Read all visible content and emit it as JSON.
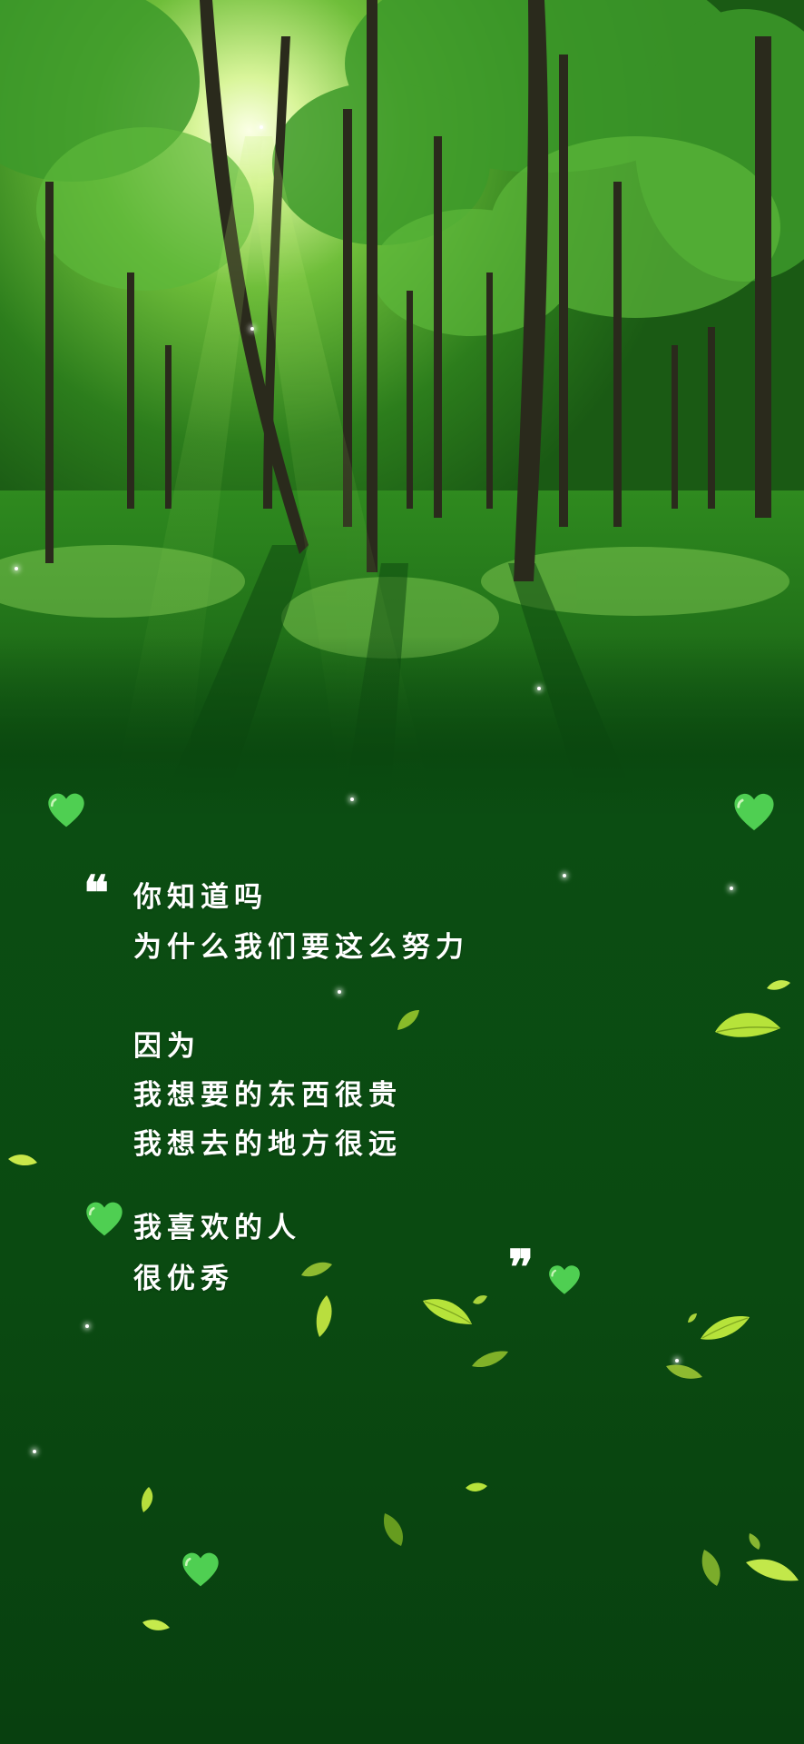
{
  "quote": {
    "open_mark": "❝",
    "close_mark": "❞",
    "lines": [
      "你知道吗",
      "为什么我们要这么努力",
      "因为",
      "我想要的东西很贵",
      "我想去的地方很远",
      "我喜欢的人",
      "很优秀"
    ]
  },
  "colors": {
    "background": "#0b4d12",
    "heart": "#4fcf52",
    "leaf": "#b6e33a",
    "text": "#ffffff"
  },
  "icons": [
    "green-heart-icon",
    "leaf-icon",
    "sparkle-icon"
  ]
}
